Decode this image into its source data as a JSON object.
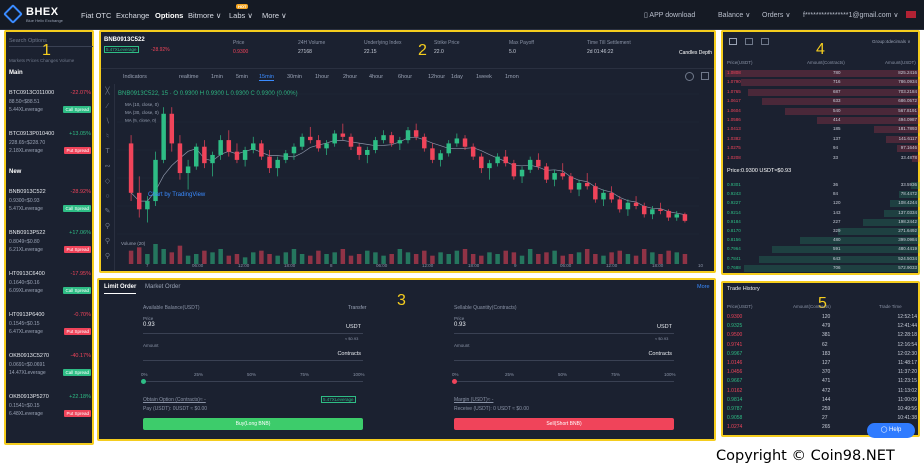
{
  "brand": {
    "name": "BHEX",
    "tagline": "Blue Helix Exchange"
  },
  "nav": [
    "Fiat OTC",
    "Exchange",
    "Options",
    "Bitmore ∨",
    "Labs ∨",
    "More ∨"
  ],
  "hot_badge": "HOT",
  "right_nav": {
    "app": "APP download",
    "balance": "Balance ∨",
    "orders": "Orders ∨",
    "email": "f****************1@gmail.com ∨"
  },
  "overlay_numbers": [
    "1",
    "2",
    "3",
    "4",
    "5"
  ],
  "left": {
    "search_placeholder": "Search Options",
    "tabs": "Markets  Prices  Changes  Volume",
    "main_label": "Main",
    "new_label": "New",
    "main_items": [
      {
        "symbol": "BTC0913C011000",
        "change": "-22.07%",
        "price": "88.50≈$88.51",
        "leverage": "5.44XLeverage",
        "badge": "Call Spread"
      },
      {
        "symbol": "BTC0913P010400",
        "change": "+13.05%",
        "price": "228.65≈$228.70",
        "leverage": "2.18XLeverage",
        "badge": "Put Spread"
      }
    ],
    "new_items": [
      {
        "symbol": "BNB0913C522",
        "change": "-28.92%",
        "price": "0.9300≈$0.93",
        "leverage": "5.47XLeverage",
        "badge": "Call Spread"
      },
      {
        "symbol": "BNB0913P522",
        "change": "+17.06%",
        "price": "0.8049≈$0.80",
        "leverage": "6.21XLeverage",
        "badge": "Put Spread"
      },
      {
        "symbol": "HT0913C6400",
        "change": "-17.95%",
        "price": "0.1640≈$0.16",
        "leverage": "6.09XLeverage",
        "badge": "Call Spread"
      },
      {
        "symbol": "HT0913P6400",
        "change": "-0.70%",
        "price": "0.1545≈$0.15",
        "leverage": "6.47XLeverage",
        "badge": "Put Spread"
      },
      {
        "symbol": "OKB0913C5270",
        "change": "-40.17%",
        "price": "0.0691≈$0.0691",
        "leverage": "14.47XLeverage",
        "badge": "Call Spread"
      },
      {
        "symbol": "OKB0913P5270",
        "change": "+22.18%",
        "price": "0.1541≈$0.15",
        "leverage": "6.48XLeverage",
        "badge": "Put Spread"
      }
    ]
  },
  "chart": {
    "symbol": "BNB0913C522",
    "leverage": "5.47XLeverage",
    "change": "-28.92%",
    "stats": [
      {
        "label": "Price",
        "value": "0.9300"
      },
      {
        "label": "24H Volume",
        "value": "27168"
      },
      {
        "label": "Underlying Index",
        "value": "22.15"
      },
      {
        "label": "Strike Price",
        "value": "22.0"
      },
      {
        "label": "Max Payoff",
        "value": "5.0"
      },
      {
        "label": "Time Till Settlement",
        "value": "2d 01:46:22"
      }
    ],
    "views": "Candles  Depth",
    "timeframes": [
      "Indicators",
      "realtime",
      "1min",
      "5min",
      "15min",
      "30min",
      "1hour",
      "2hour",
      "4hour",
      "6hour",
      "12hour",
      "1day",
      "1week",
      "1mon"
    ],
    "ohlc": "BNB0913C522, 15 ·  O 0.9300  H 0.9300  L 0.9300  C 0.9300  (0.00%)",
    "ma_lines": [
      "MA (10, close, 0)",
      "MA (30, close, 0)",
      "MA (5, close, 0)"
    ],
    "watermark": "Chart by TradingView",
    "volume_label": "Volume (20)",
    "time_ticks": [
      "7",
      "06:00",
      "12:00",
      "18:00",
      "8",
      "06:00",
      "12:00",
      "18:00",
      "9",
      "06:00",
      "12:00",
      "18:00",
      "10"
    ],
    "colors": {
      "up": "#2ebd85",
      "down": "#f0445a",
      "accent": "#3a8bff"
    }
  },
  "chart_data": {
    "type": "candlestick",
    "title": "",
    "candles": [
      [
        1.4,
        1.45,
        1.05,
        1.1
      ],
      [
        1.1,
        1.2,
        0.95,
        1.0
      ],
      [
        1.0,
        1.08,
        0.92,
        1.05
      ],
      [
        1.05,
        1.35,
        1.02,
        1.3
      ],
      [
        1.3,
        1.62,
        1.28,
        1.58
      ],
      [
        1.58,
        1.62,
        1.35,
        1.4
      ],
      [
        1.4,
        1.45,
        1.18,
        1.22
      ],
      [
        1.22,
        1.3,
        1.12,
        1.26
      ],
      [
        1.26,
        1.4,
        1.24,
        1.38
      ],
      [
        1.38,
        1.42,
        1.25,
        1.28
      ],
      [
        1.28,
        1.35,
        1.2,
        1.33
      ],
      [
        1.33,
        1.45,
        1.3,
        1.42
      ],
      [
        1.42,
        1.48,
        1.32,
        1.35
      ],
      [
        1.35,
        1.4,
        1.28,
        1.3
      ],
      [
        1.3,
        1.38,
        1.26,
        1.36
      ],
      [
        1.36,
        1.44,
        1.34,
        1.4
      ],
      [
        1.4,
        1.42,
        1.3,
        1.32
      ],
      [
        1.32,
        1.36,
        1.22,
        1.25
      ],
      [
        1.25,
        1.32,
        1.2,
        1.3
      ],
      [
        1.3,
        1.36,
        1.28,
        1.34
      ],
      [
        1.34,
        1.4,
        1.3,
        1.38
      ],
      [
        1.38,
        1.46,
        1.36,
        1.44
      ],
      [
        1.44,
        1.5,
        1.4,
        1.42
      ],
      [
        1.42,
        1.45,
        1.35,
        1.37
      ],
      [
        1.37,
        1.42,
        1.33,
        1.4
      ],
      [
        1.4,
        1.48,
        1.38,
        1.46
      ],
      [
        1.46,
        1.52,
        1.42,
        1.44
      ],
      [
        1.44,
        1.46,
        1.36,
        1.38
      ],
      [
        1.38,
        1.4,
        1.3,
        1.33
      ],
      [
        1.33,
        1.38,
        1.28,
        1.36
      ],
      [
        1.36,
        1.44,
        1.34,
        1.42
      ],
      [
        1.42,
        1.48,
        1.4,
        1.45
      ],
      [
        1.45,
        1.47,
        1.38,
        1.4
      ],
      [
        1.4,
        1.44,
        1.36,
        1.42
      ],
      [
        1.42,
        1.5,
        1.4,
        1.48
      ],
      [
        1.48,
        1.52,
        1.42,
        1.44
      ],
      [
        1.44,
        1.46,
        1.35,
        1.37
      ],
      [
        1.37,
        1.4,
        1.28,
        1.3
      ],
      [
        1.3,
        1.36,
        1.26,
        1.34
      ],
      [
        1.34,
        1.42,
        1.32,
        1.4
      ],
      [
        1.4,
        1.46,
        1.38,
        1.43
      ],
      [
        1.43,
        1.45,
        1.36,
        1.38
      ],
      [
        1.38,
        1.4,
        1.3,
        1.32
      ],
      [
        1.32,
        1.34,
        1.22,
        1.25
      ],
      [
        1.25,
        1.3,
        1.18,
        1.28
      ],
      [
        1.28,
        1.34,
        1.26,
        1.32
      ],
      [
        1.32,
        1.36,
        1.26,
        1.28
      ],
      [
        1.28,
        1.3,
        1.18,
        1.2
      ],
      [
        1.2,
        1.26,
        1.16,
        1.24
      ],
      [
        1.24,
        1.32,
        1.22,
        1.3
      ],
      [
        1.3,
        1.34,
        1.24,
        1.26
      ],
      [
        1.26,
        1.28,
        1.16,
        1.18
      ],
      [
        1.18,
        1.24,
        1.14,
        1.22
      ],
      [
        1.22,
        1.28,
        1.18,
        1.2
      ],
      [
        1.2,
        1.22,
        1.1,
        1.12
      ],
      [
        1.12,
        1.18,
        1.08,
        1.16
      ],
      [
        1.16,
        1.22,
        1.12,
        1.14
      ],
      [
        1.14,
        1.16,
        1.04,
        1.06
      ],
      [
        1.06,
        1.12,
        1.02,
        1.1
      ],
      [
        1.1,
        1.14,
        1.04,
        1.06
      ],
      [
        1.06,
        1.08,
        0.98,
        1.0
      ],
      [
        1.0,
        1.06,
        0.96,
        1.04
      ],
      [
        1.04,
        1.08,
        1.0,
        1.02
      ],
      [
        1.02,
        1.04,
        0.95,
        0.97
      ],
      [
        0.97,
        1.02,
        0.94,
        1.0
      ],
      [
        1.0,
        1.04,
        0.97,
        0.99
      ],
      [
        0.99,
        1.0,
        0.93,
        0.95
      ],
      [
        0.95,
        0.99,
        0.93,
        0.97
      ],
      [
        0.97,
        0.98,
        0.92,
        0.93
      ]
    ],
    "volumes": [
      8,
      10,
      6,
      12,
      9,
      7,
      11,
      5,
      6,
      8,
      7,
      9,
      5,
      6,
      4,
      7,
      8,
      6,
      5,
      7,
      9,
      6,
      5,
      8,
      6,
      7,
      9,
      5,
      6,
      8,
      7,
      5,
      6,
      9,
      7,
      6,
      8,
      5,
      7,
      6,
      8,
      9,
      6,
      5,
      7,
      6,
      8,
      7,
      5,
      9,
      6,
      7,
      8,
      5,
      6,
      7,
      9,
      6,
      5,
      7,
      8,
      6,
      5,
      9,
      7,
      6,
      8,
      7,
      6
    ],
    "y_range": [
      0.85,
      1.7
    ]
  },
  "order": {
    "tabs": [
      "Limit Order",
      "Market Order"
    ],
    "more": "More",
    "buy": {
      "balance_label": "Available Balance(USDT)",
      "transfer": "Transfer",
      "price_label": "Price",
      "price_value": "0.93",
      "price_unit": "USDT",
      "price_approx": "≈ $0.93",
      "amount_label": "Amount",
      "amount_unit": "Contracts",
      "pcts": [
        "0%",
        "25%",
        "50%",
        "75%",
        "100%"
      ],
      "obtain_label": "Obtain Option (Contracts)≈ -",
      "leverage": "5.47XLeverage",
      "pay_label": "Pay (USDT): 0USDT ≈ $0.00",
      "button": "Buy(Long BNB)"
    },
    "sell": {
      "qty_label": "Sellable Quantity(Contracts)",
      "price_label": "Price",
      "price_value": "0.93",
      "price_unit": "USDT",
      "price_approx": "≈ $0.93",
      "amount_label": "Amount",
      "amount_unit": "Contracts",
      "pcts": [
        "0%",
        "25%",
        "50%",
        "75%",
        "100%"
      ],
      "margin_label": "Margin (USDT)≈ -",
      "receive_label": "Receive (USDT): 0 USDT ≈ $0.00",
      "button": "Sell(Short BNB)"
    }
  },
  "book": {
    "group_label": "Group:4decimals ∨",
    "headers": [
      "Price(USDT)",
      "Amount(Contracts)",
      "Amount(USDT)"
    ],
    "asks": [
      {
        "price": "1.0808",
        "amt": "780",
        "total": "825.2416"
      },
      {
        "price": "1.0790",
        "amt": "716",
        "total": "786.0934"
      },
      {
        "price": "1.0765",
        "amt": "687",
        "total": "703.2184"
      },
      {
        "price": "1.0617",
        "amt": "633",
        "total": "686.0572"
      },
      {
        "price": "1.0604",
        "amt": "540",
        "total": "567.8191"
      },
      {
        "price": "1.0586",
        "amt": "414",
        "total": "494.0987"
      },
      {
        "price": "1.0413",
        "amt": "185",
        "total": "181.7893"
      },
      {
        "price": "1.0382",
        "amt": "137",
        "total": "141.6117"
      },
      {
        "price": "1.0275",
        "amt": "94",
        "total": "97.1646"
      },
      {
        "price": "1.0208",
        "amt": "33",
        "total": "33.4878"
      }
    ],
    "mid": "Price:0.9300 USDT≈$0.93",
    "bids": [
      {
        "price": "0.9301",
        "amt": "36",
        "total": "33.5936"
      },
      {
        "price": "0.9243",
        "amt": "84",
        "total": "78.4472"
      },
      {
        "price": "0.9227",
        "amt": "120",
        "total": "108.4244"
      },
      {
        "price": "0.9214",
        "amt": "143",
        "total": "137.0334"
      },
      {
        "price": "0.9184",
        "amt": "227",
        "total": "198.2442"
      },
      {
        "price": "0.8170",
        "amt": "329",
        "total": "271.6492"
      },
      {
        "price": "0.8156",
        "amt": "480",
        "total": "399.0984"
      },
      {
        "price": "0.7964",
        "amt": "591",
        "total": "480.4419"
      },
      {
        "price": "0.7841",
        "amt": "643",
        "total": "524.5034"
      },
      {
        "price": "0.7688",
        "amt": "706",
        "total": "572.9033"
      }
    ]
  },
  "trades": {
    "title": "Trade History",
    "headers": [
      "Price(USDT)",
      "Amount(Contracts)",
      "Trade Time"
    ],
    "rows": [
      {
        "price": "0.9300",
        "amt": "120",
        "time": "12:52:14",
        "side": "down"
      },
      {
        "price": "0.9325",
        "amt": "479",
        "time": "12:41:44",
        "side": "up"
      },
      {
        "price": "0.9500",
        "amt": "381",
        "time": "12:28:18",
        "side": "down"
      },
      {
        "price": "0.9741",
        "amt": "62",
        "time": "12:16:54",
        "side": "down"
      },
      {
        "price": "0.9967",
        "amt": "183",
        "time": "12:02:30",
        "side": "up"
      },
      {
        "price": "1.0146",
        "amt": "127",
        "time": "11:48:17",
        "side": "down"
      },
      {
        "price": "1.0456",
        "amt": "370",
        "time": "11:37:20",
        "side": "down"
      },
      {
        "price": "0.9667",
        "amt": "471",
        "time": "11:23:15",
        "side": "up"
      },
      {
        "price": "1.0162",
        "amt": "472",
        "time": "11:13:02",
        "side": "down"
      },
      {
        "price": "0.9814",
        "amt": "144",
        "time": "11:00:09",
        "side": "up"
      },
      {
        "price": "0.9787",
        "amt": "259",
        "time": "10:49:56",
        "side": "up"
      },
      {
        "price": "0.9058",
        "amt": "27",
        "time": "10:41:38",
        "side": "up"
      },
      {
        "price": "1.0274",
        "amt": "265",
        "time": "",
        "side": "down"
      }
    ]
  },
  "help": "Help",
  "copyright": "Copyright © Coin98.NET"
}
